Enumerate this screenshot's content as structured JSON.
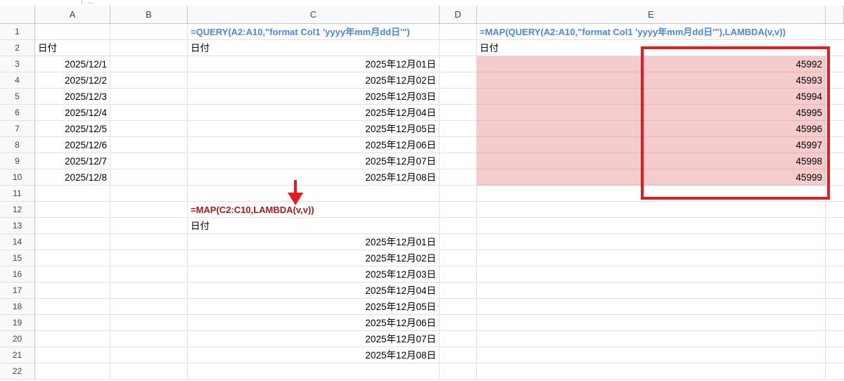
{
  "sheet": {
    "columns": [
      "A",
      "B",
      "C",
      "D",
      "E"
    ],
    "rows": [
      "1",
      "2",
      "3",
      "4",
      "5",
      "6",
      "7",
      "8",
      "9",
      "10",
      "11",
      "12",
      "13",
      "14",
      "15",
      "16",
      "17",
      "18",
      "19",
      "20",
      "21",
      "22"
    ],
    "col_a": {
      "header": "日付",
      "dates": [
        "2025/12/1",
        "2025/12/2",
        "2025/12/3",
        "2025/12/4",
        "2025/12/5",
        "2025/12/6",
        "2025/12/7",
        "2025/12/8"
      ]
    },
    "col_c": {
      "formula_query": "=QUERY(A2:A10,\"format Col1 'yyyy年mm月dd日'\")",
      "header": "日付",
      "query_results": [
        "2025年12月01日",
        "2025年12月02日",
        "2025年12月03日",
        "2025年12月04日",
        "2025年12月05日",
        "2025年12月06日",
        "2025年12月07日",
        "2025年12月08日"
      ],
      "formula_map": "=MAP(C2:C10,LAMBDA(v,v))",
      "map_header": "日付",
      "map_results": [
        "2025年12月01日",
        "2025年12月02日",
        "2025年12月03日",
        "2025年12月04日",
        "2025年12月05日",
        "2025年12月06日",
        "2025年12月07日",
        "2025年12月08日"
      ]
    },
    "col_d": {
      "formula_map_query": "=MAP(QUERY(A2:A10,\"format Col1 'yyyy年mm月dd日'\"),LAMBDA(v,v))",
      "header": "日付"
    },
    "col_e": {
      "values": [
        "45992",
        "45993",
        "45994",
        "45995",
        "45996",
        "45997",
        "45998",
        "45999"
      ]
    }
  },
  "colors": {
    "highlight_fill": "#f4cccc",
    "annotation_red": "#e02020",
    "formula_blue": "#4a86e8",
    "formula_dark_red": "#a61c1c"
  },
  "annotations": [
    "red-box-around-serial-numbers",
    "red-down-arrow"
  ]
}
